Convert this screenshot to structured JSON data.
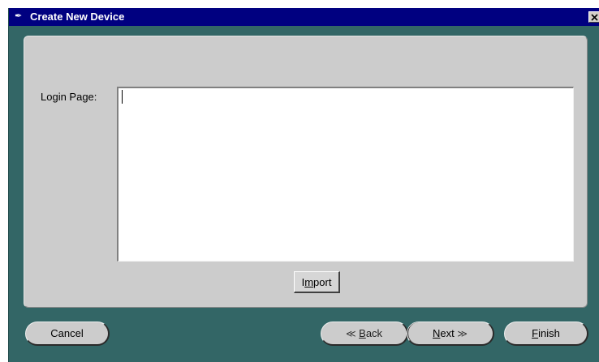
{
  "window": {
    "title": "Create New Device",
    "title_icon": "feather-icon",
    "close_icon": "close-icon"
  },
  "form": {
    "login_label": "Login Page:",
    "login_value": "",
    "import_label": "Import",
    "import_mnemonic": "m"
  },
  "buttons": {
    "cancel": "Cancel",
    "back": "Back",
    "back_mnemonic": "B",
    "back_icon": "chevron-left-double-icon",
    "next": "Next",
    "next_mnemonic": "N",
    "next_icon": "chevron-right-double-icon",
    "finish": "Finish",
    "finish_mnemonic": "F"
  },
  "colors": {
    "window_bg": "#336666",
    "titlebar_bg": "#000080",
    "panel_bg": "#cccccc"
  }
}
